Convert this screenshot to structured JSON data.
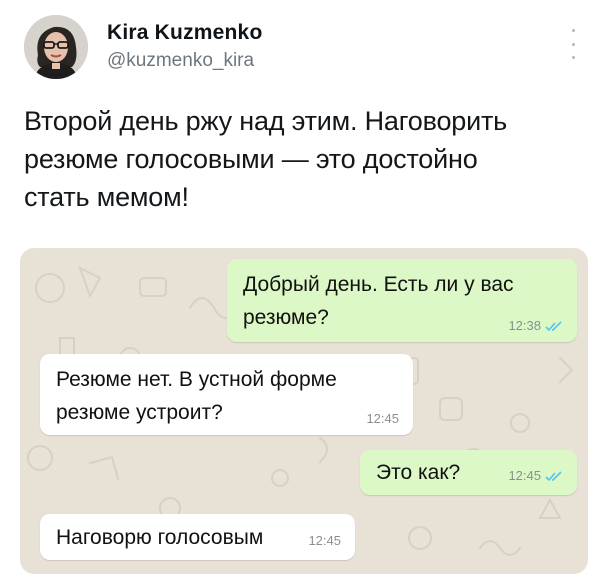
{
  "tweet": {
    "author": {
      "display_name": "Kira Kuzmenko",
      "handle": "@kuzmenko_kira",
      "avatar_icon": "profile-photo"
    },
    "more_icon": "vertical-ellipsis-icon",
    "text_lines": [
      "Второй день ржу над этим. Наговорить",
      "резюме голосовыми — это достойно",
      "стать мемом!"
    ]
  },
  "chat": {
    "background_color": "#e8e1d5",
    "outgoing_color": "#dcf8c6",
    "incoming_color": "#ffffff",
    "read_check_color": "#4fc3f7",
    "messages": [
      {
        "direction": "outgoing",
        "lines": [
          "Добрый день. Есть ли у вас",
          "резюме?"
        ],
        "time": "12:38",
        "read": true
      },
      {
        "direction": "incoming",
        "lines": [
          "Резюме нет. В устной форме",
          "резюме устроит?"
        ],
        "time": "12:45"
      },
      {
        "direction": "outgoing",
        "lines": [
          "Это как?"
        ],
        "time": "12:45",
        "read": true
      },
      {
        "direction": "incoming",
        "lines": [
          "Наговорю голосовым"
        ],
        "time": "12:45"
      }
    ]
  }
}
